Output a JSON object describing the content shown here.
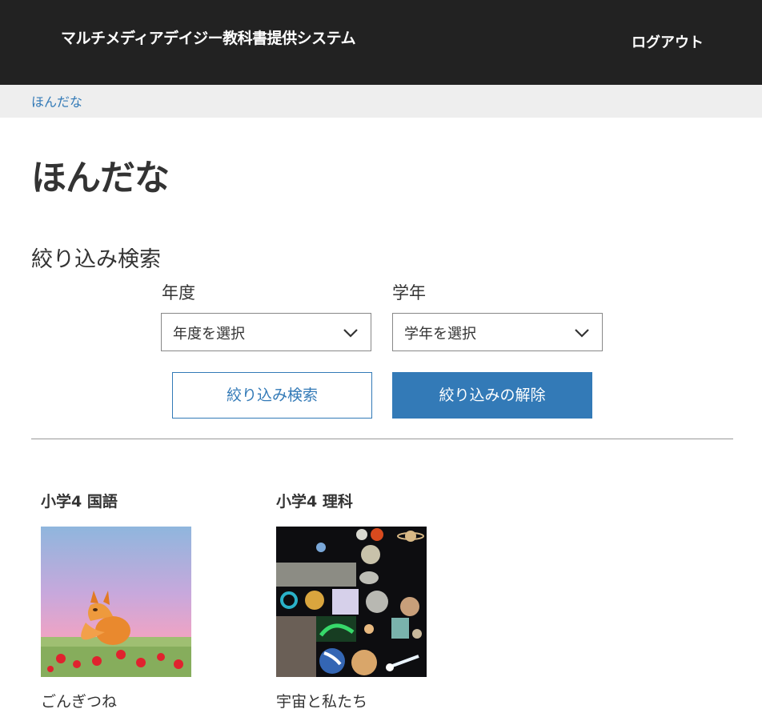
{
  "header": {
    "app_title": "マルチメディアデイジー教科書提供システム",
    "logout_label": "ログアウト",
    "bg_color": "#222222"
  },
  "breadcrumb": {
    "current": "ほんだな"
  },
  "page": {
    "title": "ほんだな"
  },
  "filter": {
    "heading": "絞り込み検索",
    "year_label": "年度",
    "year_selected": "年度を選択",
    "grade_label": "学年",
    "grade_selected": "学年を選択",
    "search_button": "絞り込み検索",
    "clear_button": "絞り込みの解除",
    "accent_color": "#337ab7"
  },
  "books": [
    {
      "title": "小学4 国語",
      "name": "ごんぎつね",
      "cover_icon": "fox-illustration-cover"
    },
    {
      "title": "小学4 理科",
      "name": "宇宙と私たち",
      "cover_icon": "space-collage-cover"
    }
  ]
}
